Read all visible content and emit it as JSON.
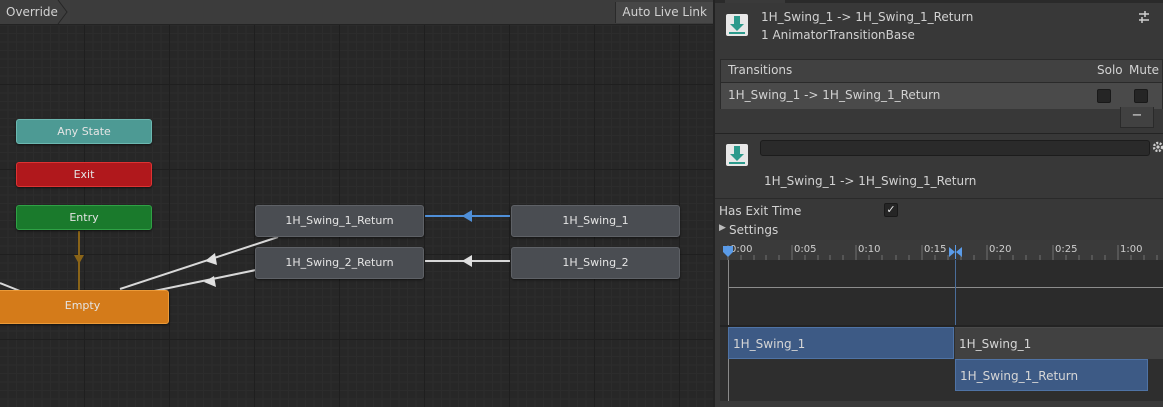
{
  "graph": {
    "breadcrumb": "Override",
    "auto_live_link": "Auto Live Link",
    "nodes": {
      "any_state": "Any State",
      "exit": "Exit",
      "entry": "Entry",
      "empty": "Empty",
      "swing1_return": "1H_Swing_1_Return",
      "swing2_return": "1H_Swing_2_Return",
      "swing1": "1H_Swing_1",
      "swing2": "1H_Swing_2"
    },
    "colors": {
      "any_state": "#4d9a94",
      "exit": "#b0181c",
      "entry": "#1a7a2c",
      "default_state": "#d47b1a",
      "selected_transition": "#4f8fd8"
    }
  },
  "inspector": {
    "title": "1H_Swing_1 -> 1H_Swing_1_Return",
    "subtitle": "1 AnimatorTransitionBase",
    "transitions_header": "Transitions",
    "solo_label": "Solo",
    "mute_label": "Mute",
    "transition_row": "1H_Swing_1 -> 1H_Swing_1_Return",
    "minus_label": "−",
    "name_field": "",
    "transition_name": "1H_Swing_1 -> 1H_Swing_1_Return",
    "has_exit_time_label": "Has Exit Time",
    "has_exit_time_checked": "✓",
    "settings_label": "Settings",
    "timeline": {
      "ticks": [
        "0:00",
        "0:05",
        "0:10",
        "0:15",
        "0:20",
        "0:25",
        "1:00"
      ],
      "source_bar": "1H_Swing_1",
      "source_bar_cont": "1H_Swing_1",
      "dest_bar": "1H_Swing_1_Return"
    }
  }
}
